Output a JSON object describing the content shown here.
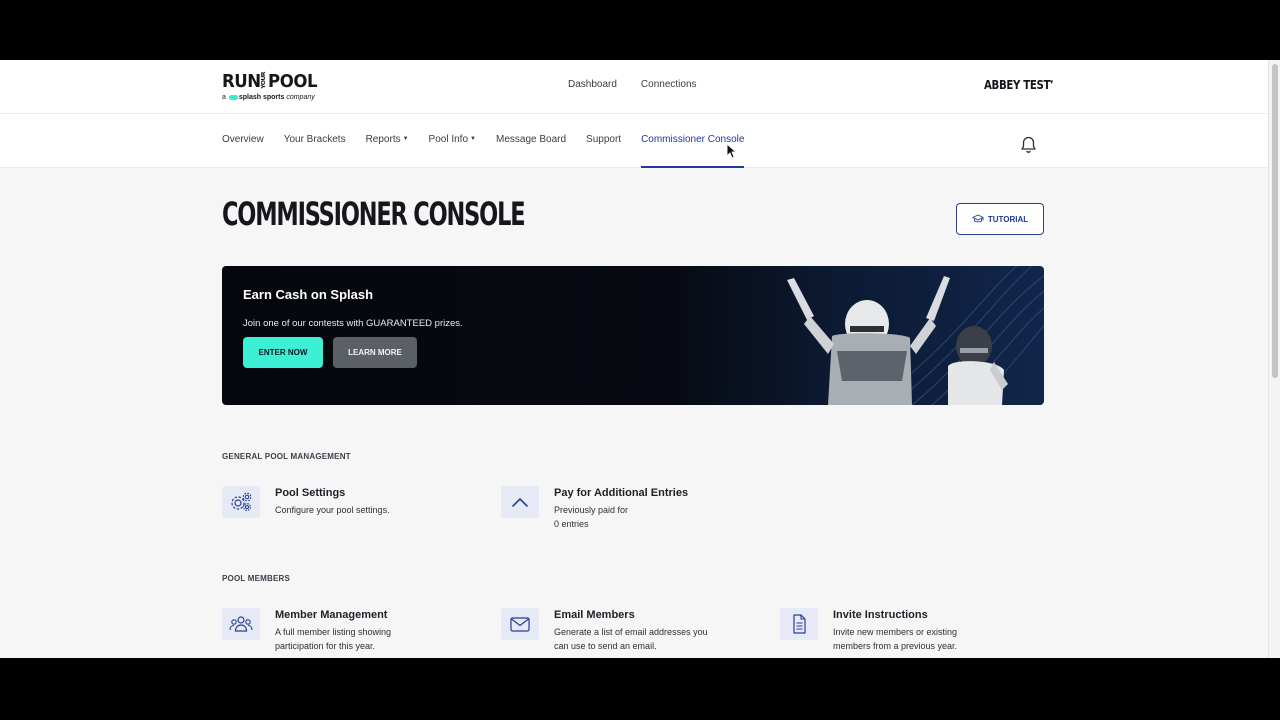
{
  "brand": {
    "logo_run": "RUN",
    "logo_your": "YOUR",
    "logo_pool": "POOL",
    "logo_sub_prefix": "a",
    "logo_sub_brand": "splash sports",
    "logo_sub_suffix": "company"
  },
  "topnav": {
    "items": [
      {
        "label": "Dashboard"
      },
      {
        "label": "Connections"
      }
    ],
    "user_label": "ABBEY TEST"
  },
  "subnav": {
    "items": [
      {
        "label": "Overview"
      },
      {
        "label": "Your Brackets"
      },
      {
        "label": "Reports",
        "dropdown": true
      },
      {
        "label": "Pool Info",
        "dropdown": true
      },
      {
        "label": "Message Board"
      },
      {
        "label": "Support"
      },
      {
        "label": "Commissioner Console",
        "active": true
      }
    ]
  },
  "page": {
    "title": "COMMISSIONER CONSOLE",
    "tutorial_label": "TUTORIAL"
  },
  "banner": {
    "title": "Earn Cash on Splash",
    "text": "Join one of our contests with GUARANTEED prizes.",
    "enter_label": "ENTER NOW",
    "learn_label": "LEARN MORE"
  },
  "sections": {
    "general": {
      "label": "GENERAL POOL MANAGEMENT",
      "cards": [
        {
          "title": "Pool Settings",
          "desc": "Configure your pool settings.",
          "icon": "gears-icon"
        },
        {
          "title": "Pay for Additional Entries",
          "desc_line1": "Previously paid for",
          "desc_line2": "0 entries",
          "icon": "chevron-up-icon"
        }
      ]
    },
    "members": {
      "label": "POOL MEMBERS",
      "cards": [
        {
          "title": "Member Management",
          "desc": "A full member listing showing participation for this year.",
          "icon": "users-icon"
        },
        {
          "title": "Email Members",
          "desc": "Generate a list of email addresses you can use to send an email.",
          "icon": "envelope-icon"
        },
        {
          "title": "Invite Instructions",
          "desc": "Invite new members or existing members from a previous year.",
          "icon": "document-icon"
        }
      ]
    }
  },
  "colors": {
    "accent": "#1e3a9a",
    "enter_button": "#3cf0d5",
    "learn_button": "#5b5f66",
    "icon_bg": "#e6eaf6"
  }
}
